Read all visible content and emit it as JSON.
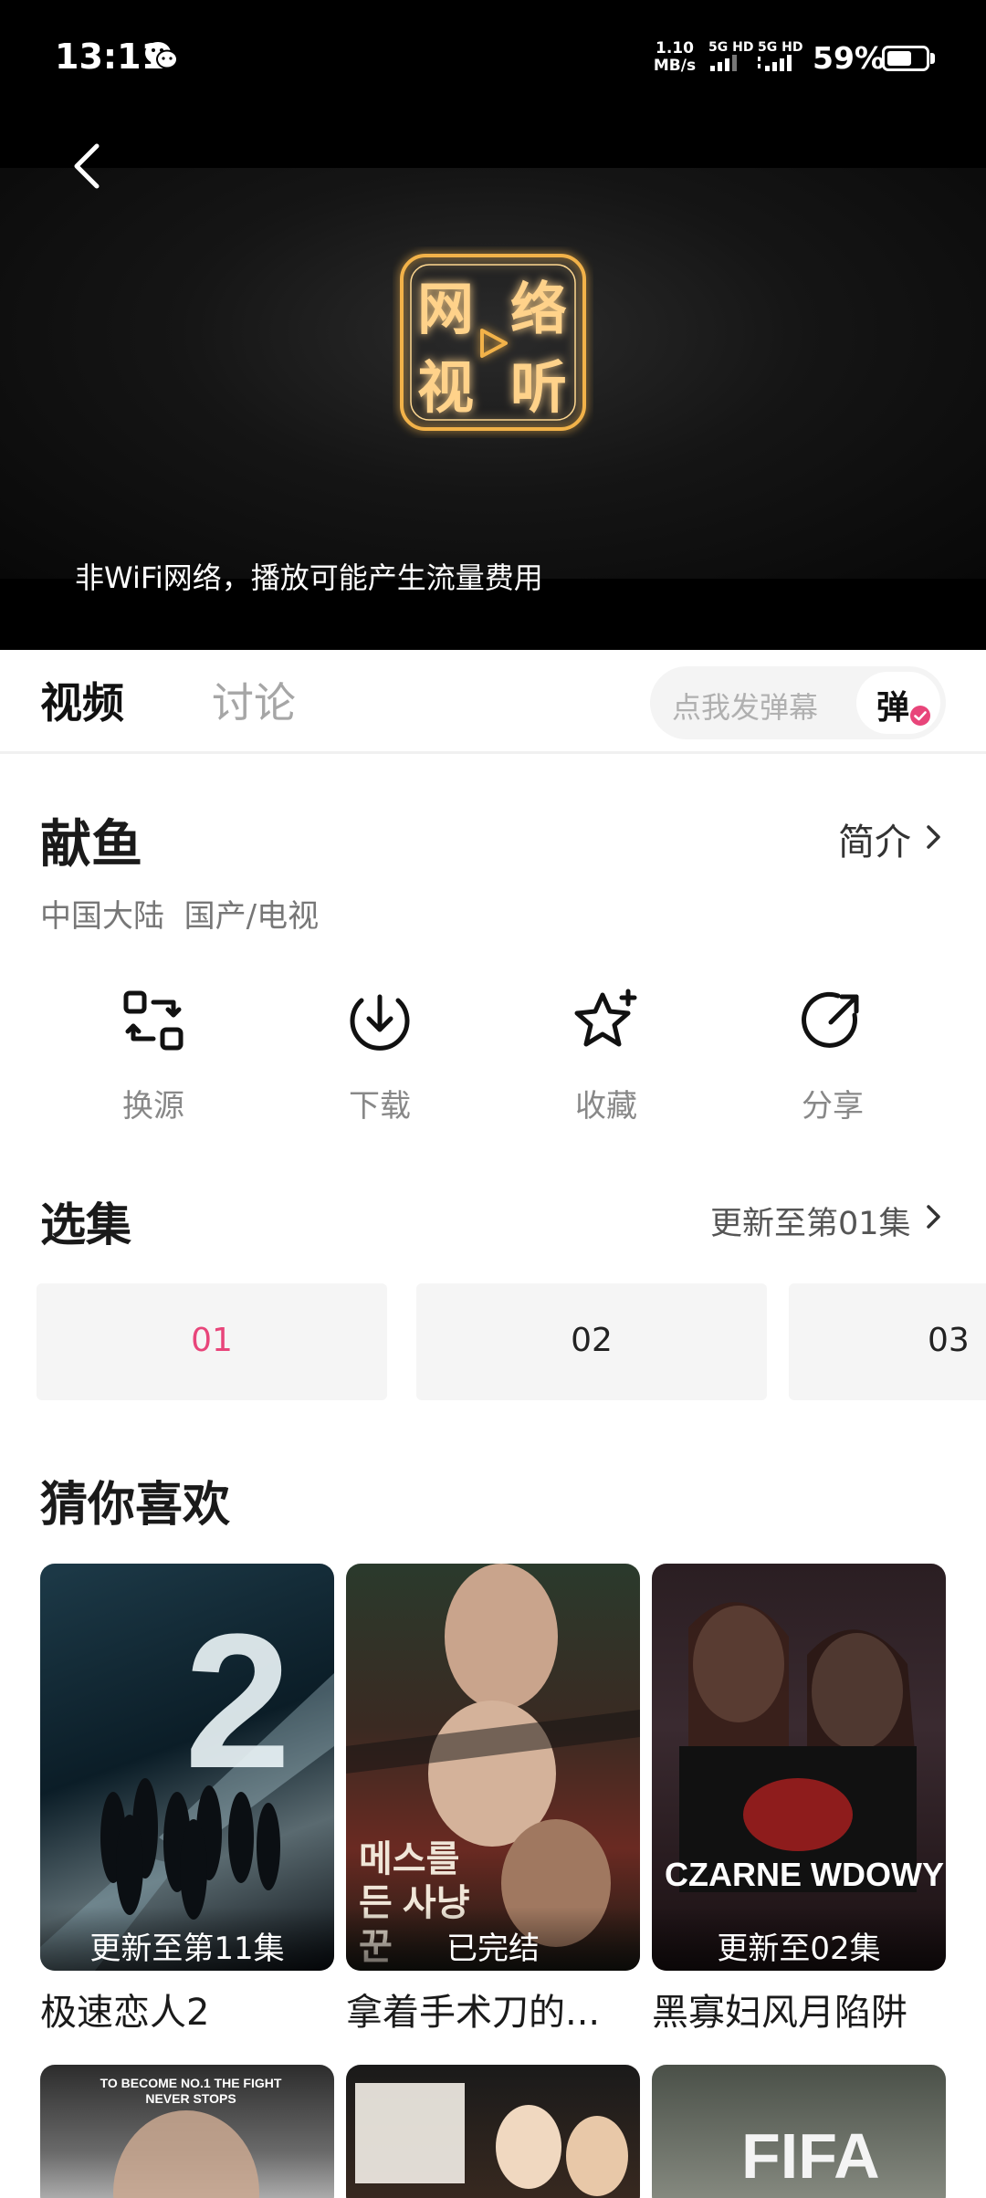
{
  "status_bar": {
    "time": "13:11",
    "net_speed_value": "1.10",
    "net_speed_unit": "MB/s",
    "sim1": "5G HD",
    "sim2": "5G HD",
    "battery": "59%",
    "battery_level": 0.59
  },
  "player": {
    "notice": "非WiFi网络，播放可能产生流量费用",
    "logo_glyphs": "网络视听"
  },
  "tabs": {
    "video": "视频",
    "discuss": "讨论"
  },
  "danmaku": {
    "placeholder": "点我发弹幕",
    "toggle_label": "弹"
  },
  "show": {
    "title": "献鱼",
    "intro_label": "简介",
    "meta": "中国大陆  国产/电视"
  },
  "actions": [
    {
      "label": "换源",
      "icon": "swap-source-icon"
    },
    {
      "label": "下载",
      "icon": "download-icon"
    },
    {
      "label": "收藏",
      "icon": "favorite-star-icon"
    },
    {
      "label": "分享",
      "icon": "share-icon"
    }
  ],
  "episodes": {
    "heading": "选集",
    "update_label": "更新至第01集",
    "items": [
      "01",
      "02",
      "03"
    ],
    "selected": "01"
  },
  "recommendations": {
    "heading": "猜你喜欢",
    "items": [
      {
        "title": "极速恋人2",
        "status": "更新至第11集",
        "art": "2"
      },
      {
        "title": "拿着手术刀的...",
        "status": "已完结",
        "art": "메스를 든 사냥꾼"
      },
      {
        "title": "黑寡妇风月陷阱",
        "status": "更新至02集",
        "art": "CZARNE WDOWY"
      },
      {
        "title": "",
        "status": "",
        "art": "TO BECOME NO.1 THE FIGHT NEVER STOPS"
      },
      {
        "title": "",
        "status": "",
        "art": ""
      },
      {
        "title": "",
        "status": "",
        "art": "FIFA"
      }
    ]
  },
  "colors": {
    "accent_pink": "#e8457a",
    "player_bg": "#000000",
    "logo_gold": "#f0a93a"
  }
}
